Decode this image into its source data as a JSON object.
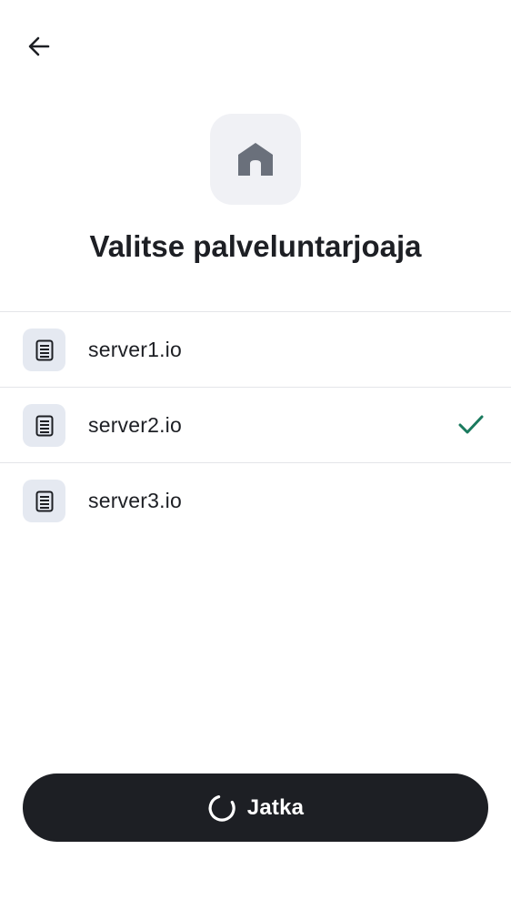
{
  "header": {
    "back_icon": "arrow-left-icon",
    "hero_icon": "home-icon",
    "title": "Valitse palveluntarjoaja"
  },
  "servers": {
    "items": [
      {
        "label": "server1.io",
        "icon": "server-icon",
        "selected": false
      },
      {
        "label": "server2.io",
        "icon": "server-icon",
        "selected": true
      },
      {
        "label": "server3.io",
        "icon": "server-icon",
        "selected": false
      }
    ],
    "check_icon": "check-icon"
  },
  "footer": {
    "continue_label": "Jatka",
    "spinner_icon": "spinner-icon"
  },
  "colors": {
    "primary_dark": "#1d1f24",
    "check_green": "#1a7a5e",
    "tile_bg": "#f0f1f5",
    "row_icon_bg": "#e5e9f1",
    "divider": "#e4e5e9"
  }
}
